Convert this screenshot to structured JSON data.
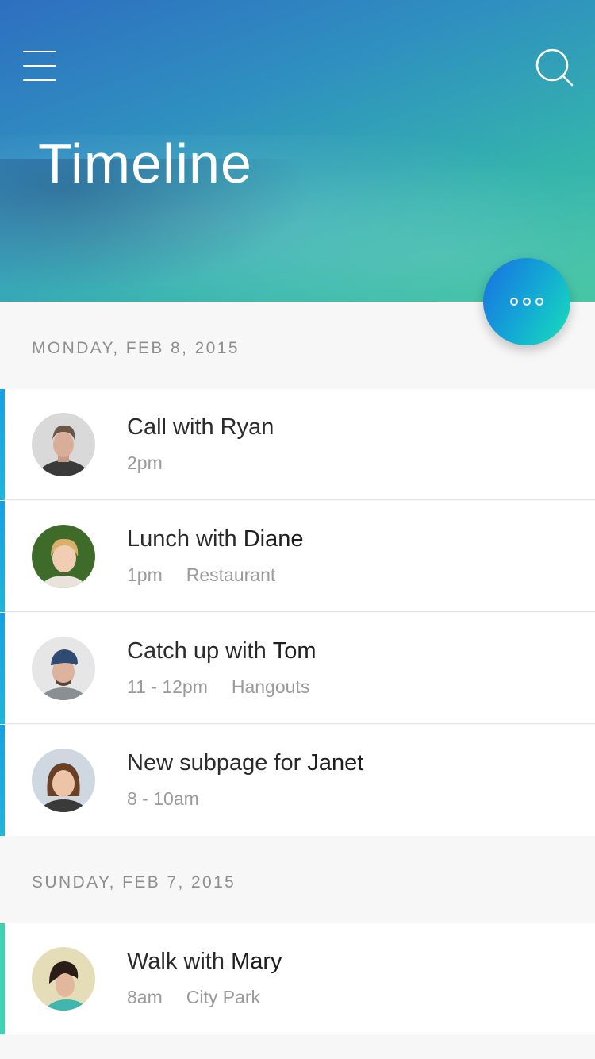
{
  "header": {
    "title": "Timeline",
    "menu_icon": "hamburger-menu-icon",
    "search_icon": "search-icon"
  },
  "fab": {
    "icon": "more-options-icon"
  },
  "colors": {
    "header_gradient_start": "#2e6fc0",
    "header_gradient_end": "#3ec4a0",
    "fab_gradient_start": "#1a6fe0",
    "fab_gradient_end": "#18e0b8",
    "accent_blue": "#1aa0e0",
    "accent_teal": "#3fd3b4"
  },
  "sections": [
    {
      "date": "MONDAY, FEB 8, 2015",
      "items": [
        {
          "title_prefix": "Call with Ryan",
          "title_name": "",
          "time": "2pm",
          "location": "",
          "avatar": "avatar-ryan"
        },
        {
          "title_prefix": "Lunch with ",
          "title_name": "Diane",
          "time": "1pm",
          "location": "Restaurant",
          "avatar": "avatar-diane"
        },
        {
          "title_prefix": "Catch up with ",
          "title_name": "Tom",
          "time": "11 - 12pm",
          "location": "Hangouts",
          "avatar": "avatar-tom"
        },
        {
          "title_prefix": "New subpage for ",
          "title_name": "Janet",
          "time": "8 - 10am",
          "location": "",
          "avatar": "avatar-janet"
        }
      ]
    },
    {
      "date": "SUNDAY, FEB 7, 2015",
      "items": [
        {
          "title_prefix": "Walk with ",
          "title_name": "Mary",
          "time": "8am",
          "location": "City Park",
          "avatar": "avatar-mary"
        }
      ]
    }
  ]
}
